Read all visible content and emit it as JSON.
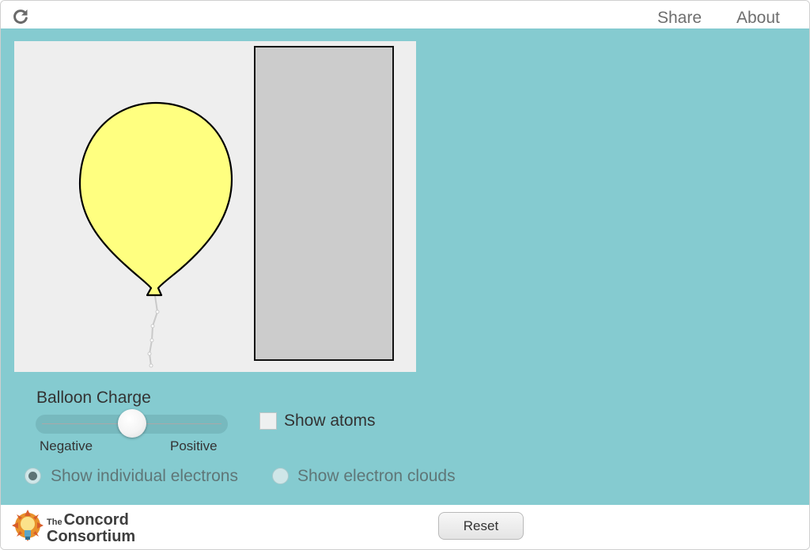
{
  "header": {
    "reload_icon": "reload-icon",
    "share_label": "Share",
    "about_label": "About"
  },
  "controls": {
    "charge_title": "Balloon Charge",
    "slider_min_label": "Negative",
    "slider_max_label": "Positive",
    "slider_value_fraction": 0.5,
    "show_atoms_label": "Show atoms",
    "show_atoms_checked": false,
    "radio_individual_label": "Show individual electrons",
    "radio_clouds_label": "Show electron clouds",
    "radio_selected": "individual"
  },
  "footer": {
    "logo_the": "The",
    "logo_line1": "Concord",
    "logo_line2": "Consortium",
    "reset_label": "Reset"
  },
  "colors": {
    "background": "#85cbd0",
    "balloon_fill": "#ffff80",
    "wall_fill": "#cccccc",
    "sim_bg": "#eeeeee"
  }
}
